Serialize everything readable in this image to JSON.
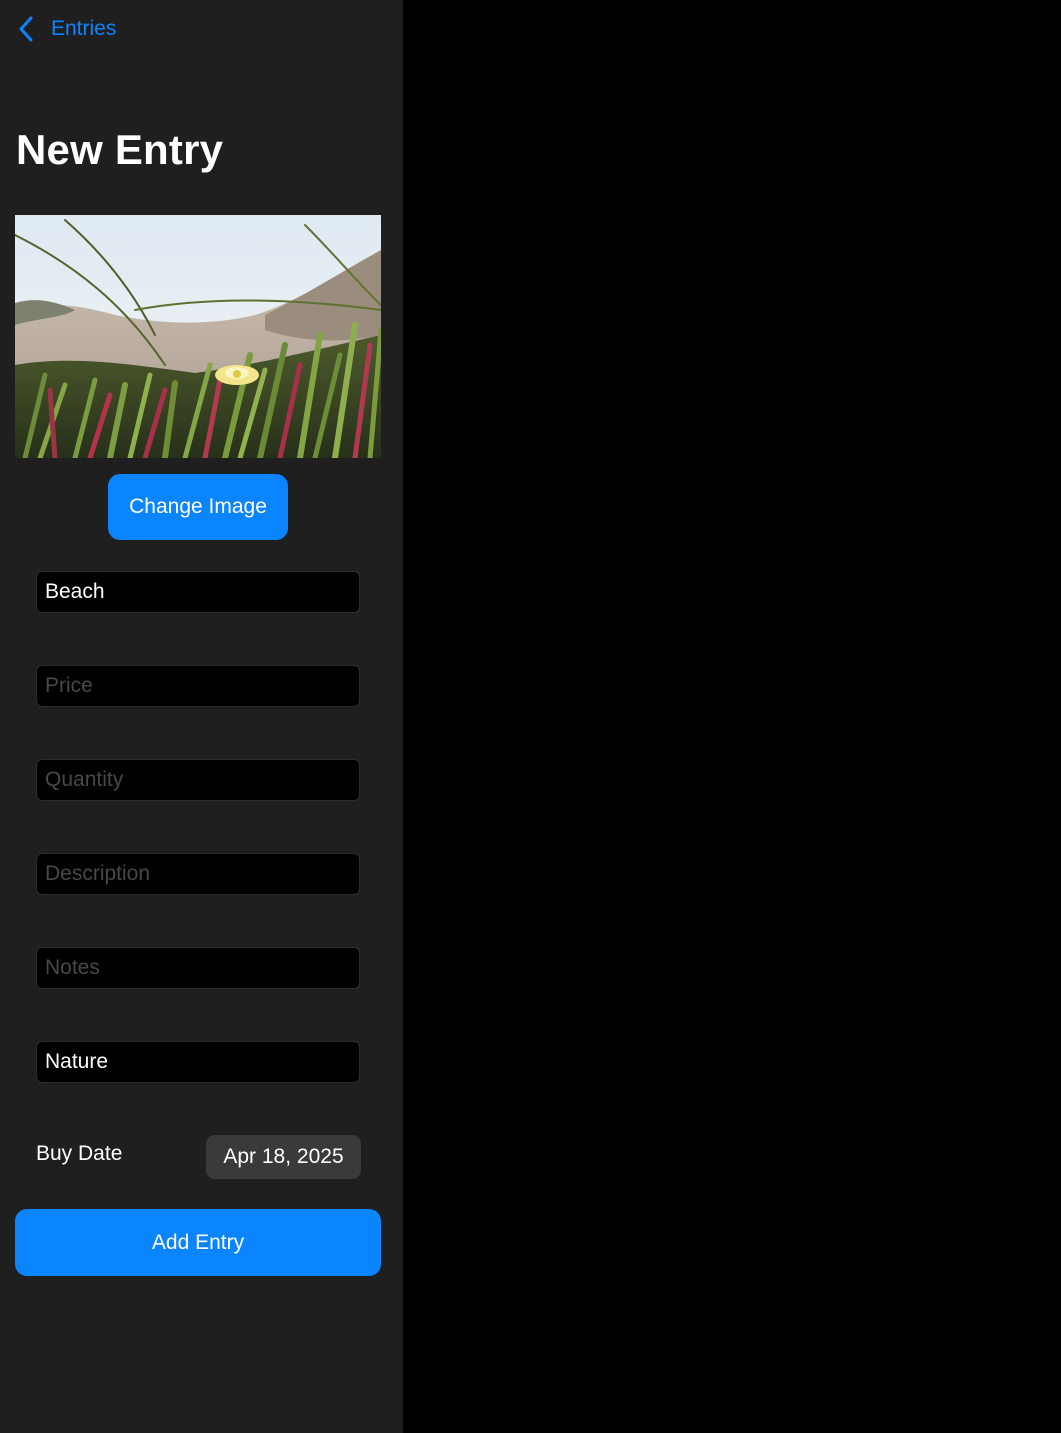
{
  "nav": {
    "back_label": "Entries",
    "back_icon": "chevron-left-icon"
  },
  "page": {
    "title": "New Entry"
  },
  "image": {
    "description_icon": "photo-thumbnail",
    "change_button_label": "Change Image"
  },
  "form": {
    "name": {
      "value": "Beach",
      "placeholder": ""
    },
    "price": {
      "value": "",
      "placeholder": "Price"
    },
    "quantity": {
      "value": "",
      "placeholder": "Quantity"
    },
    "description": {
      "value": "",
      "placeholder": "Description"
    },
    "notes": {
      "value": "",
      "placeholder": "Notes"
    },
    "category": {
      "value": "Nature",
      "placeholder": ""
    },
    "buy_date_label": "Buy Date",
    "buy_date_value": "Apr 18, 2025"
  },
  "actions": {
    "add_entry_label": "Add Entry"
  },
  "colors": {
    "accent": "#0a84ff",
    "sidebar_bg": "#1f1f20",
    "detail_bg": "#000000",
    "field_bg": "#000000",
    "placeholder": "#48484a",
    "date_pill_bg": "#3a3a3c"
  }
}
